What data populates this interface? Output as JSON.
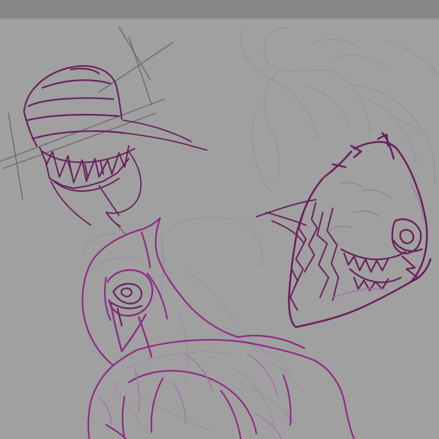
{
  "app": {
    "colors": {
      "title_bar": "#868686",
      "canvas_background": "#a0a0a0",
      "ink_dark": "#6a1f5c",
      "ink_magenta": "#8e2a84",
      "ink_light": "#a272a6",
      "ink_faint": "#9e8aa2",
      "ink_grey": "#6b5a6d"
    }
  },
  "canvas": {
    "content": "sketch-drawing"
  }
}
